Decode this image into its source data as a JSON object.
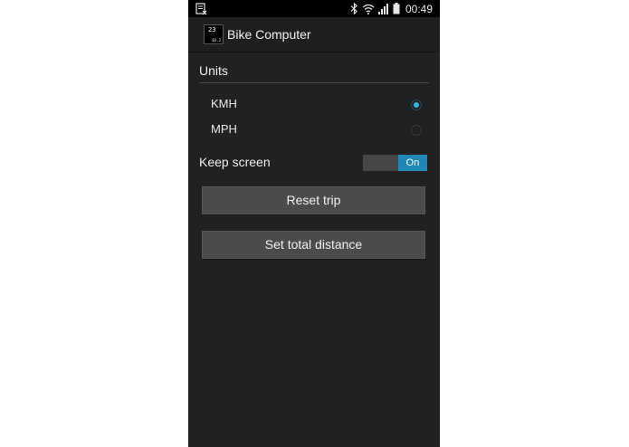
{
  "status_bar": {
    "time": "00:49",
    "icons": [
      "notification-icon",
      "bluetooth-icon",
      "wifi-icon",
      "signal-icon",
      "battery-icon"
    ]
  },
  "action_bar": {
    "title": "Bike Computer",
    "app_icon": {
      "big_text": "23",
      "small_text": "83.2"
    }
  },
  "units": {
    "header": "Units",
    "options": [
      {
        "label": "KMH",
        "checked": true
      },
      {
        "label": "MPH",
        "checked": false
      }
    ]
  },
  "keep_screen": {
    "label": "Keep screen",
    "toggle_text": "On",
    "enabled": true
  },
  "buttons": {
    "reset_trip": "Reset trip",
    "set_total_distance": "Set total distance"
  },
  "colors": {
    "accent": "#33b5e5",
    "toggle_on": "#1f87b3",
    "background": "#212121"
  }
}
